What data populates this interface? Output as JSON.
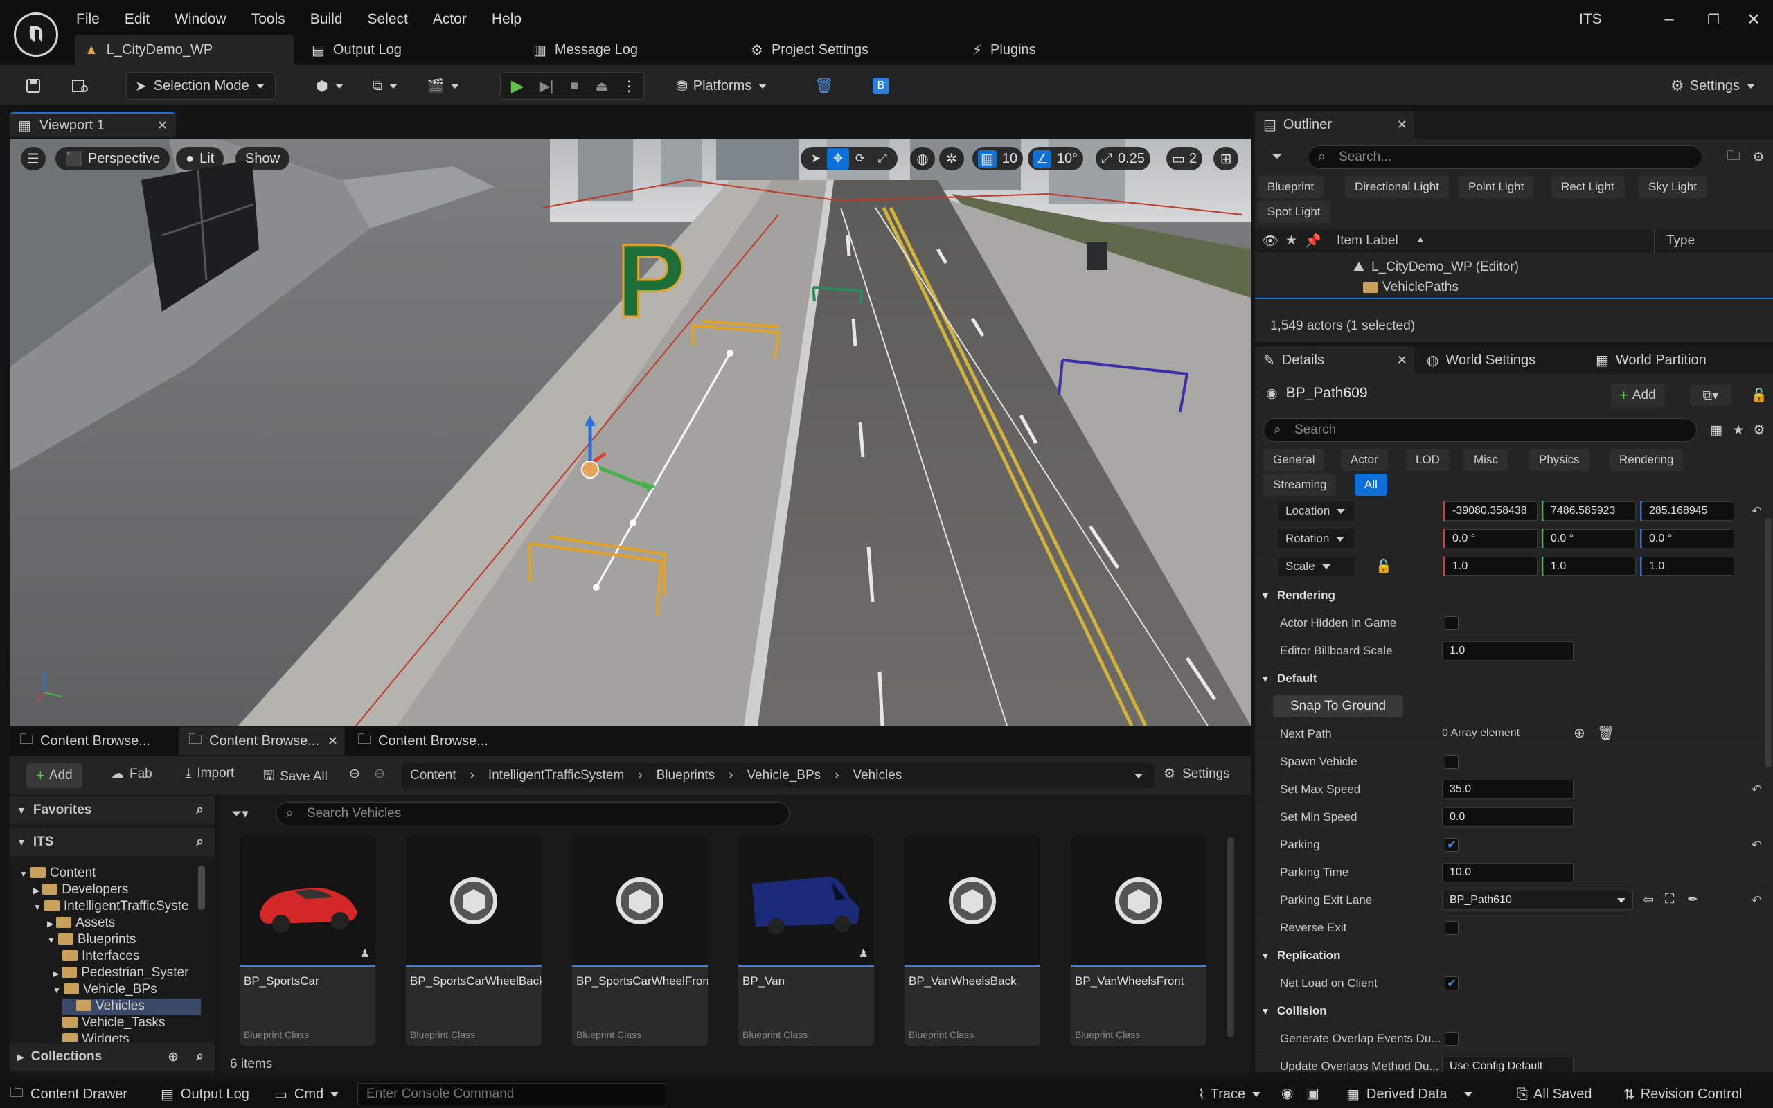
{
  "app": {
    "name": "ITS"
  },
  "menu": [
    "File",
    "Edit",
    "Window",
    "Tools",
    "Build",
    "Select",
    "Actor",
    "Help"
  ],
  "doc_tabs": [
    "L_CityDemo_WP",
    "Output Log",
    "Message Log",
    "Project Settings",
    "Plugins"
  ],
  "toolbar": {
    "selection_mode": "Selection Mode",
    "platforms": "Platforms",
    "settings": "Settings"
  },
  "viewport": {
    "tab": "Viewport 1",
    "perspective": "Perspective",
    "lit": "Lit",
    "show": "Show",
    "grid_snap": "10",
    "rotation_snap": "10°",
    "scale_snap": "0.25",
    "camera_speed": "2",
    "parking_sign": "P",
    "colors": {
      "accent": "#0c70d8",
      "parking_sign": "#1e6e3a"
    }
  },
  "outliner": {
    "title": "Outliner",
    "search_placeholder": "Search...",
    "filters": [
      "Blueprint",
      "Directional Light",
      "Point Light",
      "Rect Light",
      "Sky Light",
      "Spot Light"
    ],
    "col_label": "Item Label",
    "col_type": "Type",
    "rows": [
      "L_CityDemo_WP (Editor)",
      "VehiclePaths"
    ],
    "status": "1,549 actors (1 selected)"
  },
  "details": {
    "tabs": [
      "Details",
      "World Settings",
      "World Partition"
    ],
    "actor_name": "BP_Path609",
    "add_label": "Add",
    "search_placeholder": "Search",
    "filters": [
      "General",
      "Actor",
      "LOD",
      "Misc",
      "Physics",
      "Rendering",
      "Streaming",
      "All"
    ],
    "transform": {
      "location_label": "Location",
      "location": [
        "-39080.358438",
        "7486.585923",
        "285.168945"
      ],
      "rotation_label": "Rotation",
      "rotation": [
        "0.0 °",
        "0.0 °",
        "0.0 °"
      ],
      "scale_label": "Scale",
      "scale": [
        "1.0",
        "1.0",
        "1.0"
      ]
    },
    "sections": {
      "rendering": "Rendering",
      "default": "Default",
      "replication": "Replication",
      "collision": "Collision"
    },
    "rendering": {
      "actor_hidden_label": "Actor Hidden In Game",
      "billboard_label": "Editor Billboard Scale",
      "billboard_value": "1.0"
    },
    "default": {
      "snap_button": "Snap To Ground",
      "next_path_label": "Next Path",
      "next_path_value": "0 Array element",
      "spawn_vehicle_label": "Spawn Vehicle",
      "max_speed_label": "Set Max Speed",
      "max_speed_value": "35.0",
      "min_speed_label": "Set Min Speed",
      "min_speed_value": "0.0",
      "parking_label": "Parking",
      "parking_time_label": "Parking Time",
      "parking_time_value": "10.0",
      "exit_lane_label": "Parking Exit Lane",
      "exit_lane_value": "BP_Path610",
      "reverse_exit_label": "Reverse Exit"
    },
    "replication": {
      "net_load_label": "Net Load on Client"
    },
    "collision": {
      "overlap_label": "Generate Overlap Events Du...",
      "update_overlaps_label": "Update Overlaps Method Du...",
      "update_overlaps_value": "Use Config Default"
    }
  },
  "content_browser": {
    "tabs": [
      "Content Browse...",
      "Content Browse...",
      "Content Browse..."
    ],
    "add": "Add",
    "fab": "Fab",
    "import": "Import",
    "save_all": "Save All",
    "breadcrumb": [
      "Content",
      "IntelligentTrafficSystem",
      "Blueprints",
      "Vehicle_BPs",
      "Vehicles"
    ],
    "settings": "Settings",
    "search_placeholder": "Search Vehicles",
    "favorites": "Favorites",
    "project": "ITS",
    "tree": [
      "Content",
      "Developers",
      "IntelligentTrafficSyste",
      "Assets",
      "Blueprints",
      "Interfaces",
      "Pedestrian_Syster",
      "Vehicle_BPs",
      "Vehicles",
      "Vehicle_Tasks",
      "Widgets"
    ],
    "collections": "Collections",
    "assets": [
      {
        "name": "BP_SportsCar",
        "type": "Blueprint Class"
      },
      {
        "name": "BP_SportsCarWheelBack",
        "type": "Blueprint Class"
      },
      {
        "name": "BP_SportsCarWheelFront",
        "type": "Blueprint Class"
      },
      {
        "name": "BP_Van",
        "type": "Blueprint Class"
      },
      {
        "name": "BP_VanWheelsBack",
        "type": "Blueprint Class"
      },
      {
        "name": "BP_VanWheelsFront",
        "type": "Blueprint Class"
      }
    ],
    "item_count": "6 items"
  },
  "statusbar": {
    "content_drawer": "Content Drawer",
    "output_log": "Output Log",
    "cmd": "Cmd",
    "console_placeholder": "Enter Console Command",
    "trace": "Trace",
    "derived_data": "Derived Data",
    "all_saved": "All Saved",
    "revision_control": "Revision Control"
  }
}
